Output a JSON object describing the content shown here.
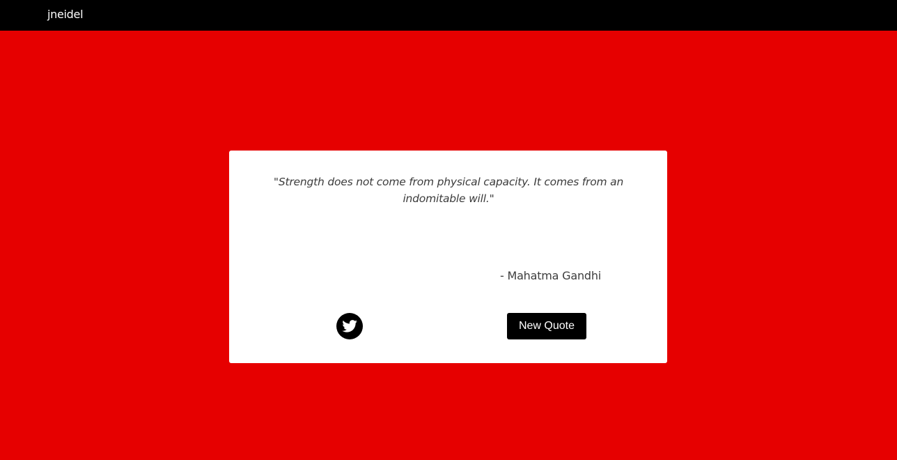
{
  "header": {
    "brand": "jneidel"
  },
  "quote_box": {
    "text": "\"Strength does not come from physical capacity. It comes from an indomitable will.\"",
    "author": "- Mahatma Gandhi",
    "tweet_icon": "twitter-icon",
    "new_quote_label": "New Quote"
  },
  "colors": {
    "background": "#e60000",
    "header": "#000000",
    "card": "#ffffff",
    "button": "#000000",
    "text": "#3c3c3c"
  }
}
